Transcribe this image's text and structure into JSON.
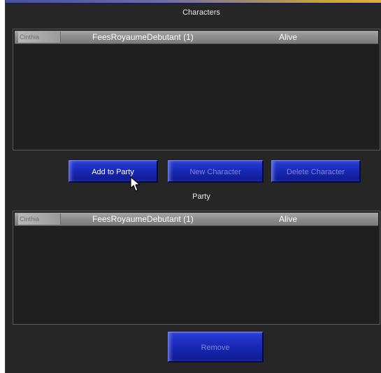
{
  "characters_section": {
    "title": "Characters",
    "rows": [
      {
        "name": "Cinthia",
        "realm": "FeesRoyaumeDebutant (1)",
        "status": "Alive"
      }
    ]
  },
  "buttons": {
    "add_to_party": "Add to Party",
    "new_character": "New Character",
    "delete_character": "Delete Character",
    "remove": "Remove"
  },
  "party_section": {
    "title": "Party",
    "rows": [
      {
        "name": "Cinthia",
        "realm": "FeesRoyaumeDebutant (1)",
        "status": "Alive"
      }
    ]
  },
  "colors": {
    "background": "#262626",
    "button_blue": "#1929b8",
    "row_gray": "#8c8c8c",
    "disabled_text": "#7e86d8"
  },
  "icons": {
    "cursor": "mouse-pointer-icon"
  }
}
